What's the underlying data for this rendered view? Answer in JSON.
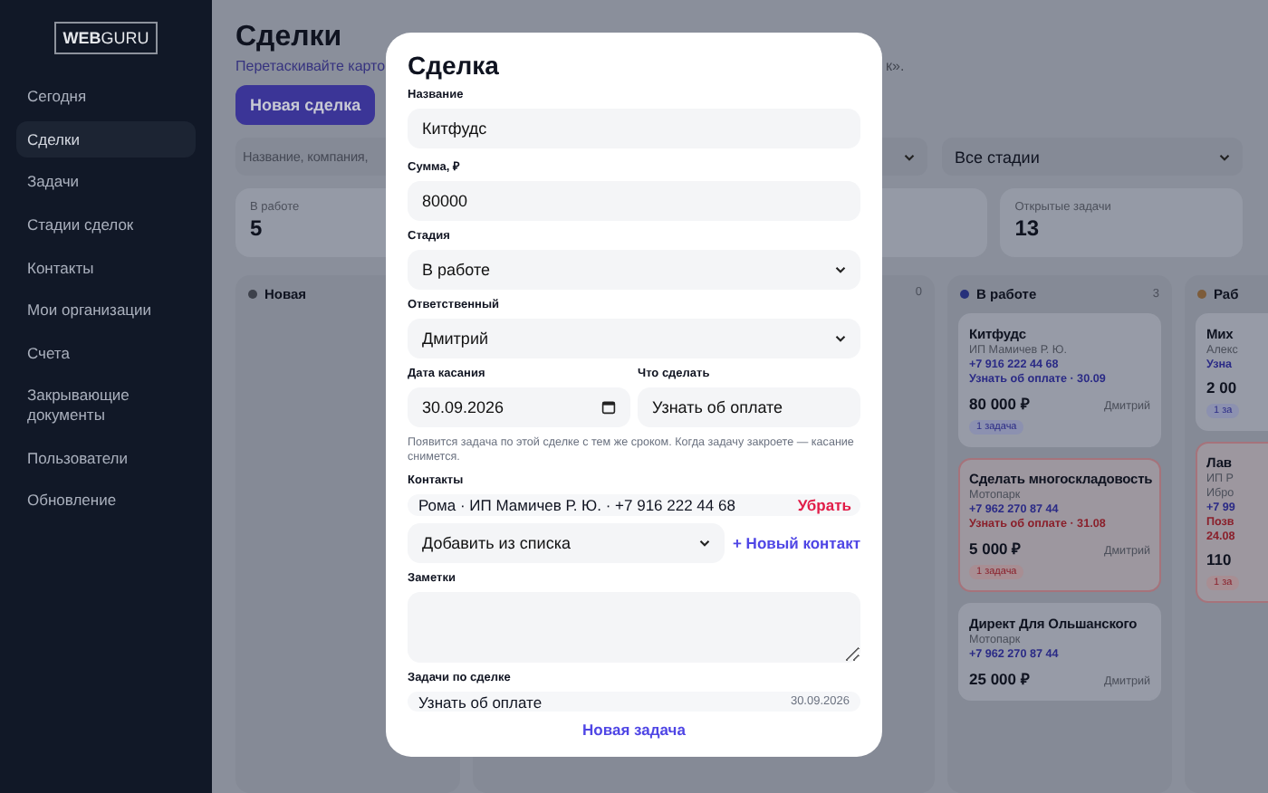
{
  "sidebar": {
    "logo": "**WEB**GURU",
    "items": [
      {
        "label": "Сегодня",
        "selected": false
      },
      {
        "label": "Сделки",
        "selected": true
      },
      {
        "label": "Задачи",
        "selected": false
      },
      {
        "label": "Стадии сделок",
        "selected": false
      },
      {
        "label": "Контакты",
        "selected": false
      },
      {
        "label": "Мои организации",
        "selected": false
      },
      {
        "label": "Счета",
        "selected": false
      },
      {
        "label": "Закрывающие документы",
        "selected": false
      },
      {
        "label": "Пользователи",
        "selected": false
      },
      {
        "label": "Обновление",
        "selected": false
      }
    ]
  },
  "page": {
    "title": "Сделки",
    "subtitle_start": "Перетаскивайте карто",
    "subtitle_end": "к».",
    "new_button": "Новая сделка",
    "search": {
      "placeholder": "Название, компания,"
    },
    "stage_filter": "Все стадии",
    "stats": [
      {
        "label": "В работе",
        "value": "5"
      },
      {
        "label": "Открытые задачи",
        "value": "13"
      }
    ],
    "columns": [
      {
        "name": "Новая",
        "color": "#3d414b"
      },
      {
        "count": "0"
      },
      {
        "name": "В работе",
        "color": "#26307a",
        "count": "3",
        "cards": [
          {
            "title": "Китфудс",
            "lines": [
              "ИП Мамичев Р. Ю."
            ],
            "phone": "+7 916 222 44 68",
            "task": "Узнать об оплате · 30.09",
            "overdue": false,
            "amount": "80 000 ₽",
            "owner": "Дмитрий",
            "badge": "1 задача"
          },
          {
            "title": "Сделать многоскладовость",
            "lines": [
              "Мотопарк"
            ],
            "phone": "+7 962 270 87 44",
            "task": "Узнать об оплате · 31.08",
            "overdue": true,
            "amount": "5 000 ₽",
            "owner": "Дмитрий",
            "badge": "1 задача"
          },
          {
            "title": "Директ Для Ольшанского",
            "lines": [
              "Мотопарк"
            ],
            "phone": "+7 962 270 87 44",
            "amount": "25 000 ₽",
            "owner": "Дмитрий",
            "overdue": false
          }
        ]
      },
      {
        "name": "Раб",
        "color": "#7d5c3a",
        "cards": [
          {
            "title": "Мих",
            "lines": [
              "Алекс"
            ],
            "task": "Узна",
            "overdue": false,
            "amount": "2 00",
            "badge": "1 за"
          },
          {
            "title": "Лав",
            "lines": [
              "ИП Р",
              "Ибро"
            ],
            "phone": "+7 99",
            "task": "Позв",
            "task_2": "24.08",
            "overdue": true,
            "amount": "110",
            "badge": "1 за"
          }
        ]
      }
    ]
  },
  "modal": {
    "title": "Сделка",
    "fields": [
      {
        "label": "Название",
        "kind": "text",
        "value": "Китфудс"
      },
      {
        "label": "Сумма, ₽",
        "kind": "text",
        "value": "80000"
      },
      {
        "label": "Стадия",
        "kind": "select",
        "value": "В работе"
      },
      {
        "label": "Ответственный",
        "kind": "select",
        "value": "Дмитрий"
      }
    ],
    "touch": {
      "date_label": "Дата касания",
      "date_value": "30.09.2026",
      "action_label": "Что сделать",
      "action_value": "Узнать об оплате",
      "hint": "Появится задача по этой сделке с тем же сроком. Когда задачу закроете — касание снимется."
    },
    "contacts": {
      "label": "Контакты",
      "items": [
        {
          "text": "Рома · ИП Мамичев Р. Ю. · +7 916 222 44 68",
          "remove": "Убрать"
        }
      ],
      "add_select": "Добавить из списка",
      "new_contact": "+ Новый контакт"
    },
    "notes": {
      "label": "Заметки"
    },
    "tasks": {
      "label": "Задачи по сделке",
      "items": [
        {
          "title": "Узнать об оплате",
          "date": "30.09.2026"
        }
      ],
      "new_task": "Новая задача"
    }
  }
}
